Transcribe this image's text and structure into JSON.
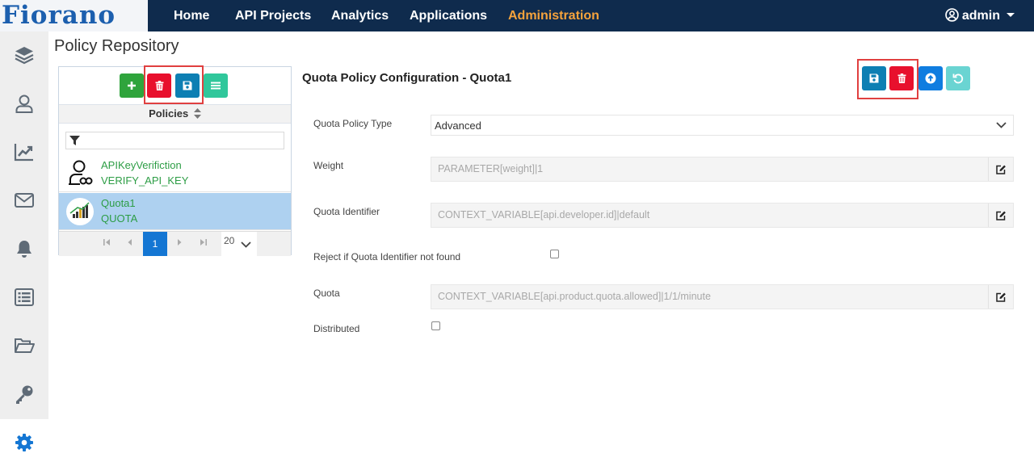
{
  "brand": {
    "logo_text": "Fiorano"
  },
  "nav": {
    "items": [
      {
        "label": "Home",
        "active": false
      },
      {
        "label": "API Projects",
        "active": false
      },
      {
        "label": "Analytics",
        "active": false
      },
      {
        "label": "Applications",
        "active": false
      },
      {
        "label": "Administration",
        "active": true
      }
    ],
    "user": "admin",
    "active_color": "#f6a33c"
  },
  "sidebar": {
    "items": [
      {
        "icon": "layers-icon"
      },
      {
        "icon": "user-icon"
      },
      {
        "icon": "chart-icon"
      },
      {
        "icon": "mail-icon"
      },
      {
        "icon": "bell-icon"
      },
      {
        "icon": "list-icon"
      },
      {
        "icon": "folder-icon"
      },
      {
        "icon": "key-icon"
      },
      {
        "icon": "gear-icon",
        "active": true
      }
    ]
  },
  "page": {
    "title": "Policy Repository"
  },
  "policy_list": {
    "header": "Policies",
    "filter_placeholder": "",
    "items": [
      {
        "name": "APIKeyVerifiction",
        "type": "VERIFY_API_KEY",
        "selected": false
      },
      {
        "name": "Quota1",
        "type": "QUOTA",
        "selected": true
      }
    ],
    "pager": {
      "current_page": "1",
      "page_size": "20"
    }
  },
  "form": {
    "title": "Quota Policy Configuration - Quota1",
    "fields": {
      "policy_type": {
        "label": "Quota Policy Type",
        "value": "Advanced"
      },
      "weight": {
        "label": "Weight",
        "value": "PARAMETER[weight]|1"
      },
      "quota_identifier": {
        "label": "Quota Identifier",
        "value": "CONTEXT_VARIABLE[api.developer.id]|default"
      },
      "reject_if_not_found": {
        "label": "Reject if Quota Identifier not found",
        "checked": false
      },
      "quota": {
        "label": "Quota",
        "value": "CONTEXT_VARIABLE[api.product.quota.allowed]|1/1/minute"
      },
      "distributed": {
        "label": "Distributed",
        "checked": false
      }
    }
  },
  "colors": {
    "topbar": "#0f2b4d",
    "add": "#2fa43c",
    "delete": "#e8102d",
    "save": "#0d7fb3",
    "highlight": "#e04040"
  }
}
